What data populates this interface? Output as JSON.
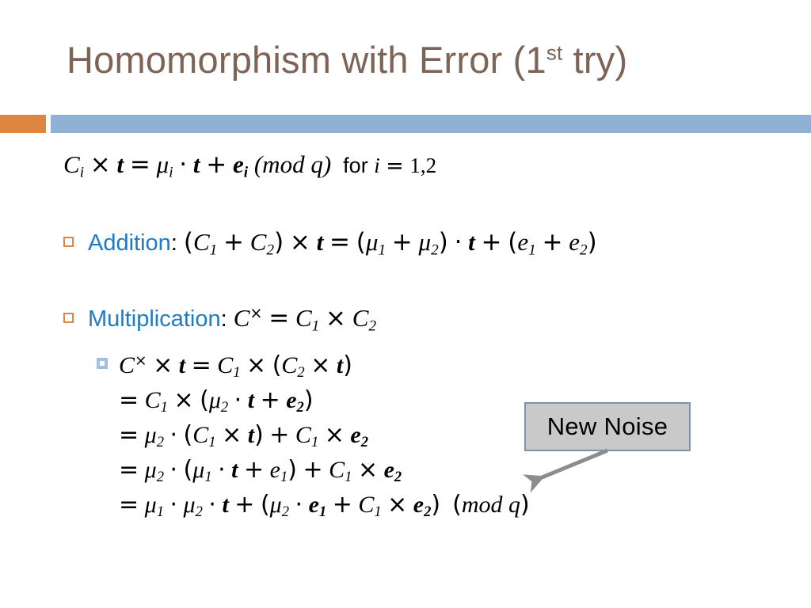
{
  "slide": {
    "title_main": "Homomorphism with Error (1",
    "title_sup": "st",
    "title_tail": " try)",
    "title_plain": "Homomorphism with Error (1st try)",
    "colors": {
      "title": "#7d6456",
      "accent_orange": "#e0853f",
      "accent_blue": "#8fb2d4",
      "bullet_text_blue": "#1f7ac4",
      "callout_fill": "#c9c9c9",
      "callout_border": "#7f93a8",
      "arrow": "#8c8c8c"
    }
  },
  "equations": {
    "top": {
      "lhs": "C",
      "lhs_sub": "i",
      "times": "×",
      "t": "t",
      "eq": "=",
      "mu": "μ",
      "mu_sub": "i",
      "dot": "·",
      "plus": "+",
      "e": "e",
      "e_sub": "i",
      "mod": "(mod q)",
      "for_text": "for",
      "index_var": "i",
      "index_values": "1,2",
      "plain": "C_i × t = μ_i · t + e_i (mod q)  for i = 1,2"
    }
  },
  "bullets": [
    {
      "id": "addition",
      "label": "Addition",
      "colon": ":",
      "bullet_glyph": "square-outline-orange",
      "body_plain": "(C_1 + C_2) × t = (μ_1 + μ_2) · t + (e_1 + e_2)"
    },
    {
      "id": "multiplication",
      "label": "Multiplication",
      "colon": ":",
      "bullet_glyph": "square-outline-orange",
      "body_plain": "C^× = C_1 × C_2"
    }
  ],
  "derivation": {
    "bullet_glyph": "square-filled-lightblue",
    "lines": [
      "C^× × t = C_1 × (C_2 × t)",
      "= C_1 × (μ_2 · t + e_2)",
      "= μ_2 · (C_1 × t) + C_1 × e_2",
      "= μ_2 · (μ_1 · t + e_1) + C_1 × e_2",
      "= μ_1 · μ_2 · t + (μ_2 · e_1 + C_1 × e_2)  (mod q)"
    ]
  },
  "callout": {
    "label": "New Noise",
    "arrow_direction": "down-left"
  }
}
